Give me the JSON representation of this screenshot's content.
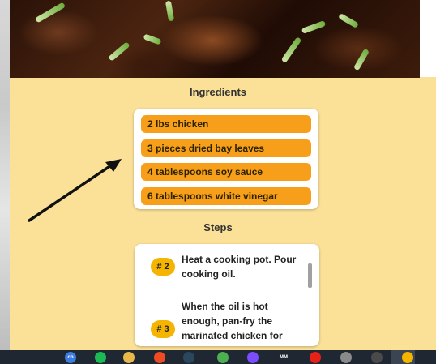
{
  "ingredients": {
    "title": "Ingredients",
    "items": [
      "2 lbs chicken",
      "3 pieces dried bay leaves",
      "4 tablespoons soy sauce",
      "6 tablespoons white vinegar"
    ]
  },
  "steps": {
    "title": "Steps",
    "items": [
      {
        "badge": "# 2",
        "text": "Heat a cooking pot. Pour cooking oil."
      },
      {
        "badge": "# 3",
        "text": "When the oil is hot enough, pan-fry the marinated chicken for"
      }
    ]
  },
  "taskbar": {
    "icons": [
      {
        "name": "copilot-icon",
        "color": "#3d7de0",
        "glyph": "cb"
      },
      {
        "name": "spotify-icon",
        "color": "#1db954",
        "glyph": ""
      },
      {
        "name": "file-explorer-icon",
        "color": "#e8b84a",
        "glyph": ""
      },
      {
        "name": "brave-icon",
        "color": "#ef4b23",
        "glyph": ""
      },
      {
        "name": "steam-icon",
        "color": "#2a475e",
        "glyph": ""
      },
      {
        "name": "chrome-icon",
        "color": "#4caf50",
        "glyph": ""
      },
      {
        "name": "app-icon",
        "color": "#7c4dff",
        "glyph": ""
      },
      {
        "name": "mm-app-icon",
        "color": "#1f2733",
        "glyph": "MM"
      },
      {
        "name": "youtube-icon",
        "color": "#e62117",
        "glyph": ""
      },
      {
        "name": "phone-icon",
        "color": "#8a8a8a",
        "glyph": ""
      },
      {
        "name": "game-icon",
        "color": "#4a4a4a",
        "glyph": ""
      },
      {
        "name": "chrome-active-icon",
        "color": "#f4b400",
        "glyph": ""
      }
    ]
  }
}
